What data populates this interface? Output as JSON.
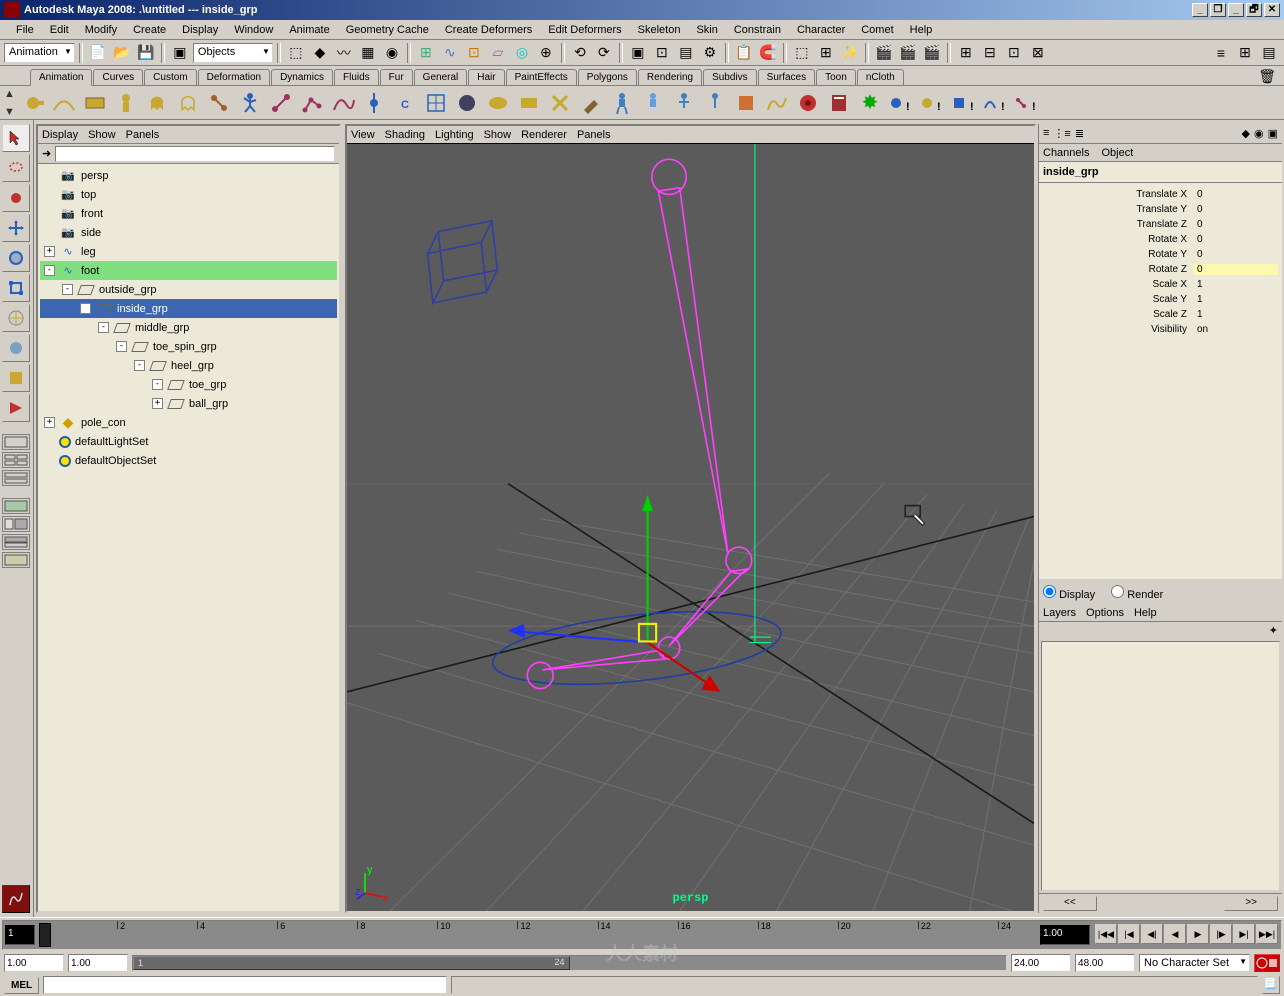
{
  "title": "Autodesk Maya 2008: .\\untitled   ---   inside_grp",
  "window_buttons": {
    "min": "_",
    "max": "❐",
    "restore": "🗗",
    "close": "✕"
  },
  "menubar": [
    "File",
    "Edit",
    "Modify",
    "Create",
    "Display",
    "Window",
    "Animate",
    "Geometry Cache",
    "Create Deformers",
    "Edit Deformers",
    "Skeleton",
    "Skin",
    "Constrain",
    "Character",
    "Comet",
    "Help"
  ],
  "status_line": {
    "module_dropdown": "Animation",
    "selection_mode": "Objects"
  },
  "shelf_tabs": [
    "Animation",
    "Curves",
    "Custom",
    "Deformation",
    "Dynamics",
    "Fluids",
    "Fur",
    "General",
    "Hair",
    "PaintEffects",
    "Polygons",
    "Rendering",
    "Subdivs",
    "Surfaces",
    "Toon",
    "nCloth"
  ],
  "shelf_active_tab": "Animation",
  "outliner": {
    "menu": [
      "Display",
      "Show",
      "Panels"
    ],
    "items": [
      {
        "indent": 0,
        "expand": "",
        "icon": "cam",
        "label": "persp"
      },
      {
        "indent": 0,
        "expand": "",
        "icon": "cam",
        "label": "top"
      },
      {
        "indent": 0,
        "expand": "",
        "icon": "cam",
        "label": "front"
      },
      {
        "indent": 0,
        "expand": "",
        "icon": "cam",
        "label": "side"
      },
      {
        "indent": 0,
        "expand": "+",
        "icon": "curve",
        "label": "leg"
      },
      {
        "indent": 0,
        "expand": "-",
        "icon": "curve",
        "label": "foot",
        "hl": "curve"
      },
      {
        "indent": 1,
        "expand": "-",
        "icon": "xform",
        "label": "outside_grp"
      },
      {
        "indent": 2,
        "expand": "-",
        "icon": "xform",
        "label": "inside_grp",
        "hl": "sel"
      },
      {
        "indent": 3,
        "expand": "-",
        "icon": "xform",
        "label": "middle_grp"
      },
      {
        "indent": 4,
        "expand": "-",
        "icon": "xform",
        "label": "toe_spin_grp"
      },
      {
        "indent": 5,
        "expand": "-",
        "icon": "xform",
        "label": "heel_grp"
      },
      {
        "indent": 6,
        "expand": "-",
        "icon": "xform",
        "label": "toe_grp"
      },
      {
        "indent": 6,
        "expand": "+",
        "icon": "xform",
        "label": "ball_grp"
      },
      {
        "indent": 0,
        "expand": "+",
        "icon": "set",
        "label": "pole_con"
      },
      {
        "indent": 0,
        "expand": "",
        "icon": "objset",
        "label": "defaultLightSet"
      },
      {
        "indent": 0,
        "expand": "",
        "icon": "objset",
        "label": "defaultObjectSet"
      }
    ]
  },
  "viewport": {
    "menu": [
      "View",
      "Shading",
      "Lighting",
      "Show",
      "Renderer",
      "Panels"
    ],
    "camera_label": "persp",
    "axis_labels": {
      "x": "x",
      "y": "y",
      "z": "z"
    }
  },
  "channel_box": {
    "tabs": [
      "Channels",
      "Object"
    ],
    "object_name": "inside_grp",
    "attrs": [
      {
        "label": "Translate X",
        "value": "0"
      },
      {
        "label": "Translate Y",
        "value": "0"
      },
      {
        "label": "Translate Z",
        "value": "0"
      },
      {
        "label": "Rotate X",
        "value": "0"
      },
      {
        "label": "Rotate Y",
        "value": "0"
      },
      {
        "label": "Rotate Z",
        "value": "0",
        "highlight": true
      },
      {
        "label": "Scale X",
        "value": "1"
      },
      {
        "label": "Scale Y",
        "value": "1"
      },
      {
        "label": "Scale Z",
        "value": "1"
      },
      {
        "label": "Visibility",
        "value": "on"
      }
    ]
  },
  "layers": {
    "radio_display": "Display",
    "radio_render": "Render",
    "menu": [
      "Layers",
      "Options",
      "Help"
    ],
    "scroll_left": "<<",
    "scroll_right": ">>"
  },
  "timeline": {
    "start_field": "1",
    "current_field": "1.00",
    "ticks": [
      "2",
      "4",
      "6",
      "8",
      "10",
      "12",
      "14",
      "16",
      "18",
      "20",
      "22",
      "24"
    ],
    "range_start": "1.00",
    "range_inner_start": "1.00",
    "range_inner_display_start": "1",
    "range_inner_display_end": "24",
    "range_inner_end": "24.00",
    "range_end": "48.00",
    "charset": "No Character Set",
    "playback_buttons": [
      "|◀◀",
      "|◀",
      "◀|",
      "◀",
      "▶",
      "|▶",
      "▶|",
      "▶▶|"
    ]
  },
  "cmd_line": {
    "label": "MEL"
  },
  "watermark": "人人素材"
}
